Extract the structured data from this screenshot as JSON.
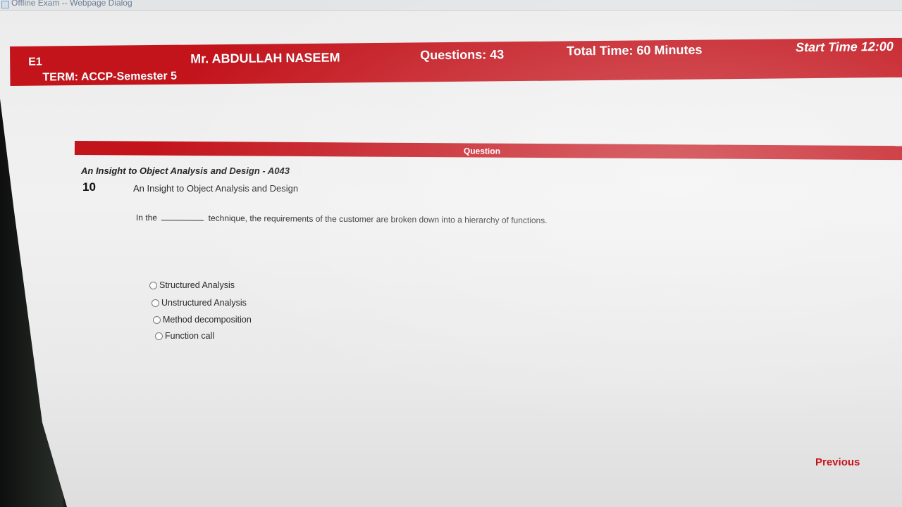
{
  "window": {
    "title": "Offline Exam -- Webpage Dialog"
  },
  "header": {
    "code": "E1",
    "term": "TERM: ACCP-Semester 5",
    "teacher": "Mr. ABDULLAH NASEEM",
    "questions": "Questions:  43",
    "total_time": "Total Time:  60 Minutes",
    "start_time": "Start Time  12:00"
  },
  "question_panel": {
    "label": "Question",
    "subject_code": "An Insight to Object Analysis and Design - A043",
    "number": "10",
    "subject": "An Insight to Object Analysis and Design",
    "text_before": "In the",
    "text_after": "technique, the requirements of the customer are broken down into a hierarchy of functions.",
    "options": [
      "Structured Analysis",
      "Unstructured Analysis",
      "Method decomposition",
      "Function call"
    ]
  },
  "navigation": {
    "previous_label": "Previous"
  },
  "colors": {
    "accent": "#c3141c",
    "background": "#ececec"
  }
}
